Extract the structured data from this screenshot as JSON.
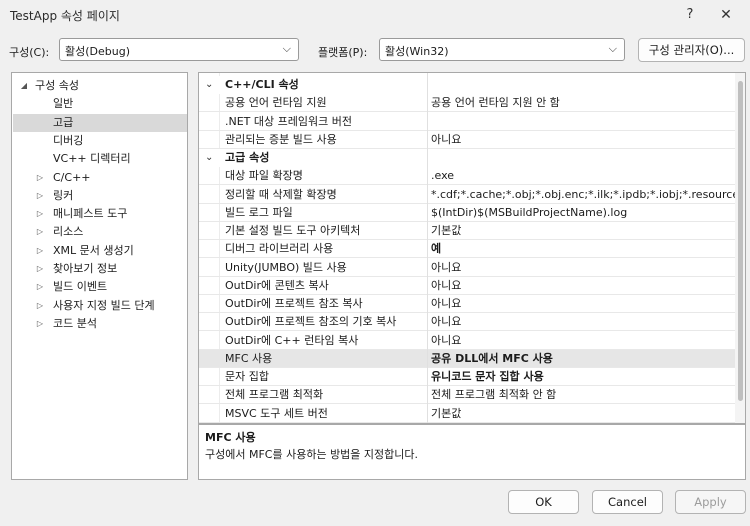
{
  "window": {
    "title": "TestApp 속성 페이지",
    "help": "?",
    "close": "✕"
  },
  "toolbar": {
    "config_label": "구성(C):",
    "config_value": "활성(Debug)",
    "platform_label": "플랫폼(P):",
    "platform_value": "활성(Win32)",
    "config_manager": "구성 관리자(O)..."
  },
  "tree": [
    {
      "label": "구성 속성",
      "arrow": "◢",
      "depth": 0
    },
    {
      "label": "일반",
      "arrow": "",
      "depth": 1
    },
    {
      "label": "고급",
      "arrow": "",
      "depth": 1,
      "selected": true
    },
    {
      "label": "디버깅",
      "arrow": "",
      "depth": 1
    },
    {
      "label": "VC++ 디렉터리",
      "arrow": "",
      "depth": 1
    },
    {
      "label": "C/C++",
      "arrow": "▷",
      "depth": 1
    },
    {
      "label": "링커",
      "arrow": "▷",
      "depth": 1
    },
    {
      "label": "매니페스트 도구",
      "arrow": "▷",
      "depth": 1
    },
    {
      "label": "리소스",
      "arrow": "▷",
      "depth": 1
    },
    {
      "label": "XML 문서 생성기",
      "arrow": "▷",
      "depth": 1
    },
    {
      "label": "찾아보기 정보",
      "arrow": "▷",
      "depth": 1
    },
    {
      "label": "빌드 이벤트",
      "arrow": "▷",
      "depth": 1
    },
    {
      "label": "사용자 지정 빌드 단계",
      "arrow": "▷",
      "depth": 1
    },
    {
      "label": "코드 분석",
      "arrow": "▷",
      "depth": 1
    }
  ],
  "grid": {
    "sections": [
      {
        "title": "C++/CLI 속성",
        "rows": [
          {
            "name": "공용 언어 런타임 지원",
            "value": "공용 언어 런타임 지원 안 함"
          },
          {
            "name": ".NET 대상 프레임워크 버전",
            "value": ""
          },
          {
            "name": "관리되는 증분 빌드 사용",
            "value": "아니요"
          }
        ]
      },
      {
        "title": "고급 속성",
        "rows": [
          {
            "name": "대상 파일 확장명",
            "value": ".exe"
          },
          {
            "name": "정리할 때 삭제할 확장명",
            "value": "*.cdf;*.cache;*.obj;*.obj.enc;*.ilk;*.ipdb;*.iobj;*.resources;*.t"
          },
          {
            "name": "빌드 로그 파일",
            "value": "$(IntDir)$(MSBuildProjectName).log"
          },
          {
            "name": "기본 설정 빌드 도구 아키텍처",
            "value": "기본값"
          },
          {
            "name": "디버그 라이브러리 사용",
            "value": "예",
            "bold": true
          },
          {
            "name": "Unity(JUMBO) 빌드 사용",
            "value": "아니요"
          },
          {
            "name": "OutDir에 콘텐츠 복사",
            "value": "아니요"
          },
          {
            "name": "OutDir에 프로젝트 참조 복사",
            "value": "아니요"
          },
          {
            "name": "OutDir에 프로젝트 참조의 기호 복사",
            "value": "아니요"
          },
          {
            "name": "OutDir에 C++ 런타임 복사",
            "value": "아니요"
          },
          {
            "name": "MFC 사용",
            "value": "공유 DLL에서 MFC 사용",
            "bold": true,
            "selected": true
          },
          {
            "name": "문자 집합",
            "value": "유니코드 문자 집합 사용",
            "bold": true
          },
          {
            "name": "전체 프로그램 최적화",
            "value": "전체 프로그램 최적화 안 함"
          },
          {
            "name": "MSVC 도구 세트 버전",
            "value": "기본값"
          }
        ]
      }
    ]
  },
  "description": {
    "title": "MFC 사용",
    "text": "구성에서 MFC를 사용하는 방법을 지정합니다."
  },
  "footer": {
    "ok": "OK",
    "cancel": "Cancel",
    "apply": "Apply"
  }
}
